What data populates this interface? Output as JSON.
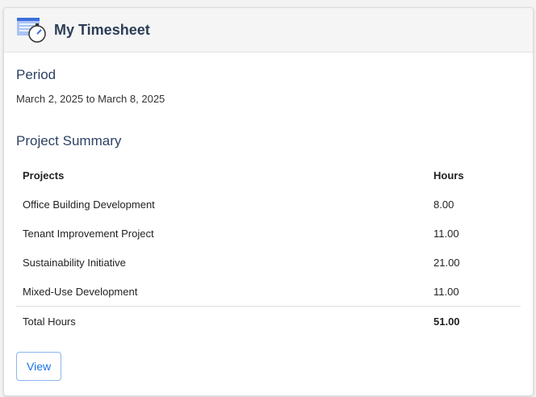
{
  "header": {
    "title": "My Timesheet",
    "icon": "timesheet-stopwatch-icon"
  },
  "period": {
    "heading": "Period",
    "range": "March 2, 2025 to March 8, 2025"
  },
  "summary": {
    "heading": "Project Summary",
    "columns": [
      "Projects",
      "Hours"
    ],
    "rows": [
      {
        "project": "Office Building Development",
        "hours": "8.00"
      },
      {
        "project": "Tenant Improvement Project",
        "hours": "11.00"
      },
      {
        "project": "Sustainability Initiative",
        "hours": "21.00"
      },
      {
        "project": "Mixed-Use Development",
        "hours": "11.00"
      }
    ],
    "total_label": "Total Hours",
    "total": "51.00"
  },
  "actions": {
    "view": "View"
  }
}
